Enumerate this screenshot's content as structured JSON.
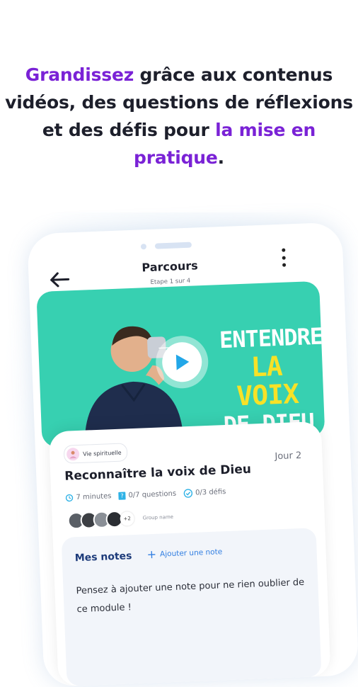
{
  "headline": {
    "part1_highlight": "Grandissez",
    "part2": " grâce aux contenus vidéos, des questions de réflexions et des défis pour ",
    "part3_highlight": "la mise en pratique",
    "part4": "."
  },
  "colors": {
    "accent_purple": "#7a22d6",
    "video_bg": "#37d0b1",
    "link_blue": "#2f7de1",
    "title_yellow": "#f7e227"
  },
  "header": {
    "title": "Parcours",
    "subtitle": "Etape 1 sur 4",
    "back_icon": "arrow-left-icon",
    "menu_icon": "more-vertical-icon"
  },
  "video": {
    "title_line1": "ENTENDRE",
    "title_line2": "LA VOIX",
    "title_line3": "DE DIEU",
    "play_icon": "play-icon"
  },
  "module": {
    "tag_label": "Vie spirituelle",
    "day_label": "Jour 2",
    "title": "Reconnaître la voix de Dieu",
    "duration": "7 minutes",
    "questions": "0/7 questions",
    "challenges": "0/3 défis",
    "group_extra": "+2",
    "group_name": "Group name"
  },
  "notes": {
    "title": "Mes notes",
    "add_label": "Ajouter une note",
    "placeholder_text": "Pensez à ajouter une note pour ne rien oublier de ce module !"
  }
}
